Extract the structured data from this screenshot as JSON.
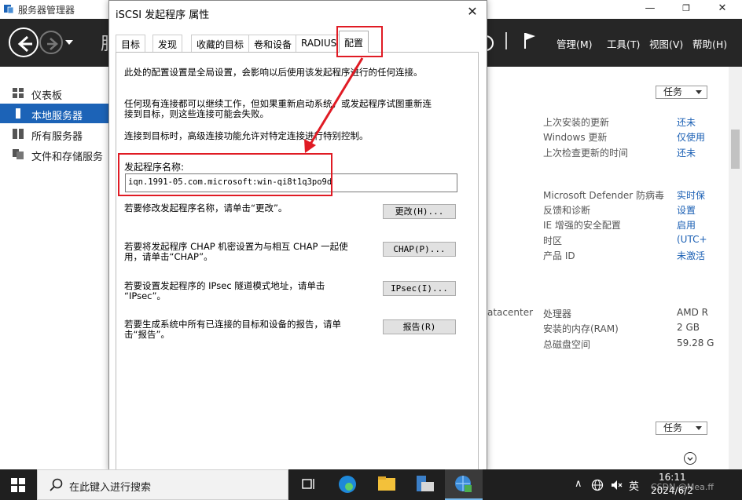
{
  "server_manager": {
    "window_title": "服务器管理器",
    "title_letter": "服",
    "menu": [
      "管理(M)",
      "工具(T)",
      "视图(V)",
      "帮助(H)"
    ],
    "sidebar": [
      {
        "label": "仪表板",
        "icon": "dashboard-icon"
      },
      {
        "label": "本地服务器",
        "icon": "local-server-icon",
        "active": true
      },
      {
        "label": "所有服务器",
        "icon": "all-servers-icon"
      },
      {
        "label": "文件和存储服务",
        "icon": "file-storage-icon"
      }
    ],
    "tasks_label": "任务",
    "properties_top": [
      {
        "label": "上次安装的更新",
        "value": "还未"
      },
      {
        "label": "Windows 更新",
        "value": "仅使用"
      },
      {
        "label": "上次检查更新的时间",
        "value": "还未"
      }
    ],
    "properties_mid": [
      {
        "label": "Microsoft Defender 防病毒",
        "value": "实时保"
      },
      {
        "label": "反馈和诊断",
        "value": "设置"
      },
      {
        "label": "IE 增强的安全配置",
        "value": "启用"
      },
      {
        "label": "时区",
        "value": "(UTC+"
      },
      {
        "label": "产品 ID",
        "value": "未激活"
      }
    ],
    "partial_text": "atacenter",
    "properties_hw": [
      {
        "label": "处理器",
        "value": "AMD R"
      },
      {
        "label": "安装的内存(RAM)",
        "value": "2 GB"
      },
      {
        "label": "总磁盘空间",
        "value": "59.28 G"
      }
    ],
    "tasks_label_2": "任务"
  },
  "dialog": {
    "title": "iSCSI 发起程序 属性",
    "tabs": [
      "目标",
      "发现",
      "收藏的目标",
      "卷和设备",
      "RADIUS",
      "配置"
    ],
    "active_tab": "配置",
    "intro": "此处的配置设置是全局设置，会影响以后使用该发起程序进行的任何连接。",
    "warning_line1": "任何现有连接都可以继续工作，但如果重新启动系统，或发起程序试图重新连",
    "warning_line2": "接到目标，则这些连接可能会失败。",
    "advanced_note": "连接到目标时，高级连接功能允许对特定连接进行特别控制。",
    "initiator_name_label": "发起程序名称:",
    "initiator_name": "iqn.1991-05.com.microsoft:win-qi8t1q3po9d",
    "rows": [
      {
        "text1": "若要修改发起程序名称，请单击“更改”。",
        "text2": "",
        "button": "更改(H)..."
      },
      {
        "text1": "若要将发起程序 CHAP 机密设置为与相互 CHAP 一起使",
        "text2": "用，请单击“CHAP”。",
        "button": "CHAP(P)..."
      },
      {
        "text1": "若要设置发起程序的 IPsec 隧道模式地址，请单击",
        "text2": "“IPsec”。",
        "button": "IPsec(I)..."
      },
      {
        "text1": "若要生成系统中所有已连接的目标和设备的报告，请单",
        "text2": "击“报告”。",
        "button": "报告(R)"
      }
    ]
  },
  "taskbar": {
    "search_placeholder": "在此键入进行搜索",
    "ime": "英",
    "time": "16:11",
    "date": "2024/6/2",
    "watermark": "CSDN @Mea.ff"
  },
  "colors": {
    "toolbar_bg": "#262626",
    "sidebar_active": "#1c63b7",
    "link_blue": "#1a5fb4",
    "annotation_red": "#e01b24",
    "taskbar_bg": "#1f1f1f"
  }
}
